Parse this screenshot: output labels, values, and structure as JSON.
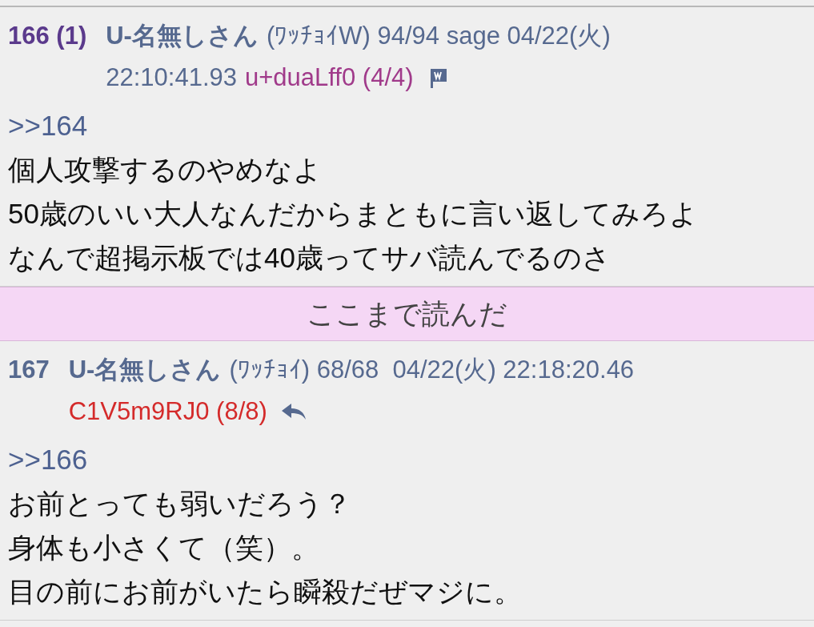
{
  "posts": [
    {
      "number": "166",
      "reply_count": "(1)",
      "color": "#5b3a8c",
      "meta_lines": [
        [
          {
            "kind": "name",
            "text": "U-名無しさん"
          },
          {
            "kind": "plain",
            "text": "(ﾜｯﾁｮｲW) 94/94 sage 04/22(火)"
          }
        ],
        [
          {
            "kind": "plain",
            "text": "22:10:41.93"
          },
          {
            "kind": "id",
            "text": "u+duaLff0 (4/4)",
            "color": "#a03a8a"
          },
          {
            "kind": "flag"
          }
        ]
      ],
      "lines": [
        {
          "kind": "anchor",
          "text": ">>164"
        },
        {
          "kind": "text",
          "text": "個人攻撃するのやめなよ"
        },
        {
          "kind": "text",
          "text": "50歳のいい大人なんだからまともに言い返してみろよ"
        },
        {
          "kind": "text",
          "text": "なんで超掲示板では40歳ってサバ読んでるのさ"
        }
      ]
    },
    {
      "kind": "divider",
      "text": "ここまで読んだ"
    },
    {
      "number": "167",
      "color": "#56698f",
      "meta_lines": [
        [
          {
            "kind": "name",
            "text": "U-名無しさん"
          },
          {
            "kind": "plain",
            "text": "(ﾜｯﾁｮｲ) 68/68  04/22(火) 22:18:20.46"
          }
        ],
        [
          {
            "kind": "id",
            "text": "C1V5m9RJ0 (8/8)",
            "color": "#d42a2a"
          },
          {
            "kind": "reply"
          }
        ]
      ],
      "lines": [
        {
          "kind": "anchor",
          "text": ">>166"
        },
        {
          "kind": "text",
          "text": "お前とっても弱いだろう？"
        },
        {
          "kind": "text",
          "text": "身体も小さくて（笑）。"
        },
        {
          "kind": "text",
          "text": "目の前にお前がいたら瞬殺だぜマジに。"
        }
      ]
    }
  ]
}
